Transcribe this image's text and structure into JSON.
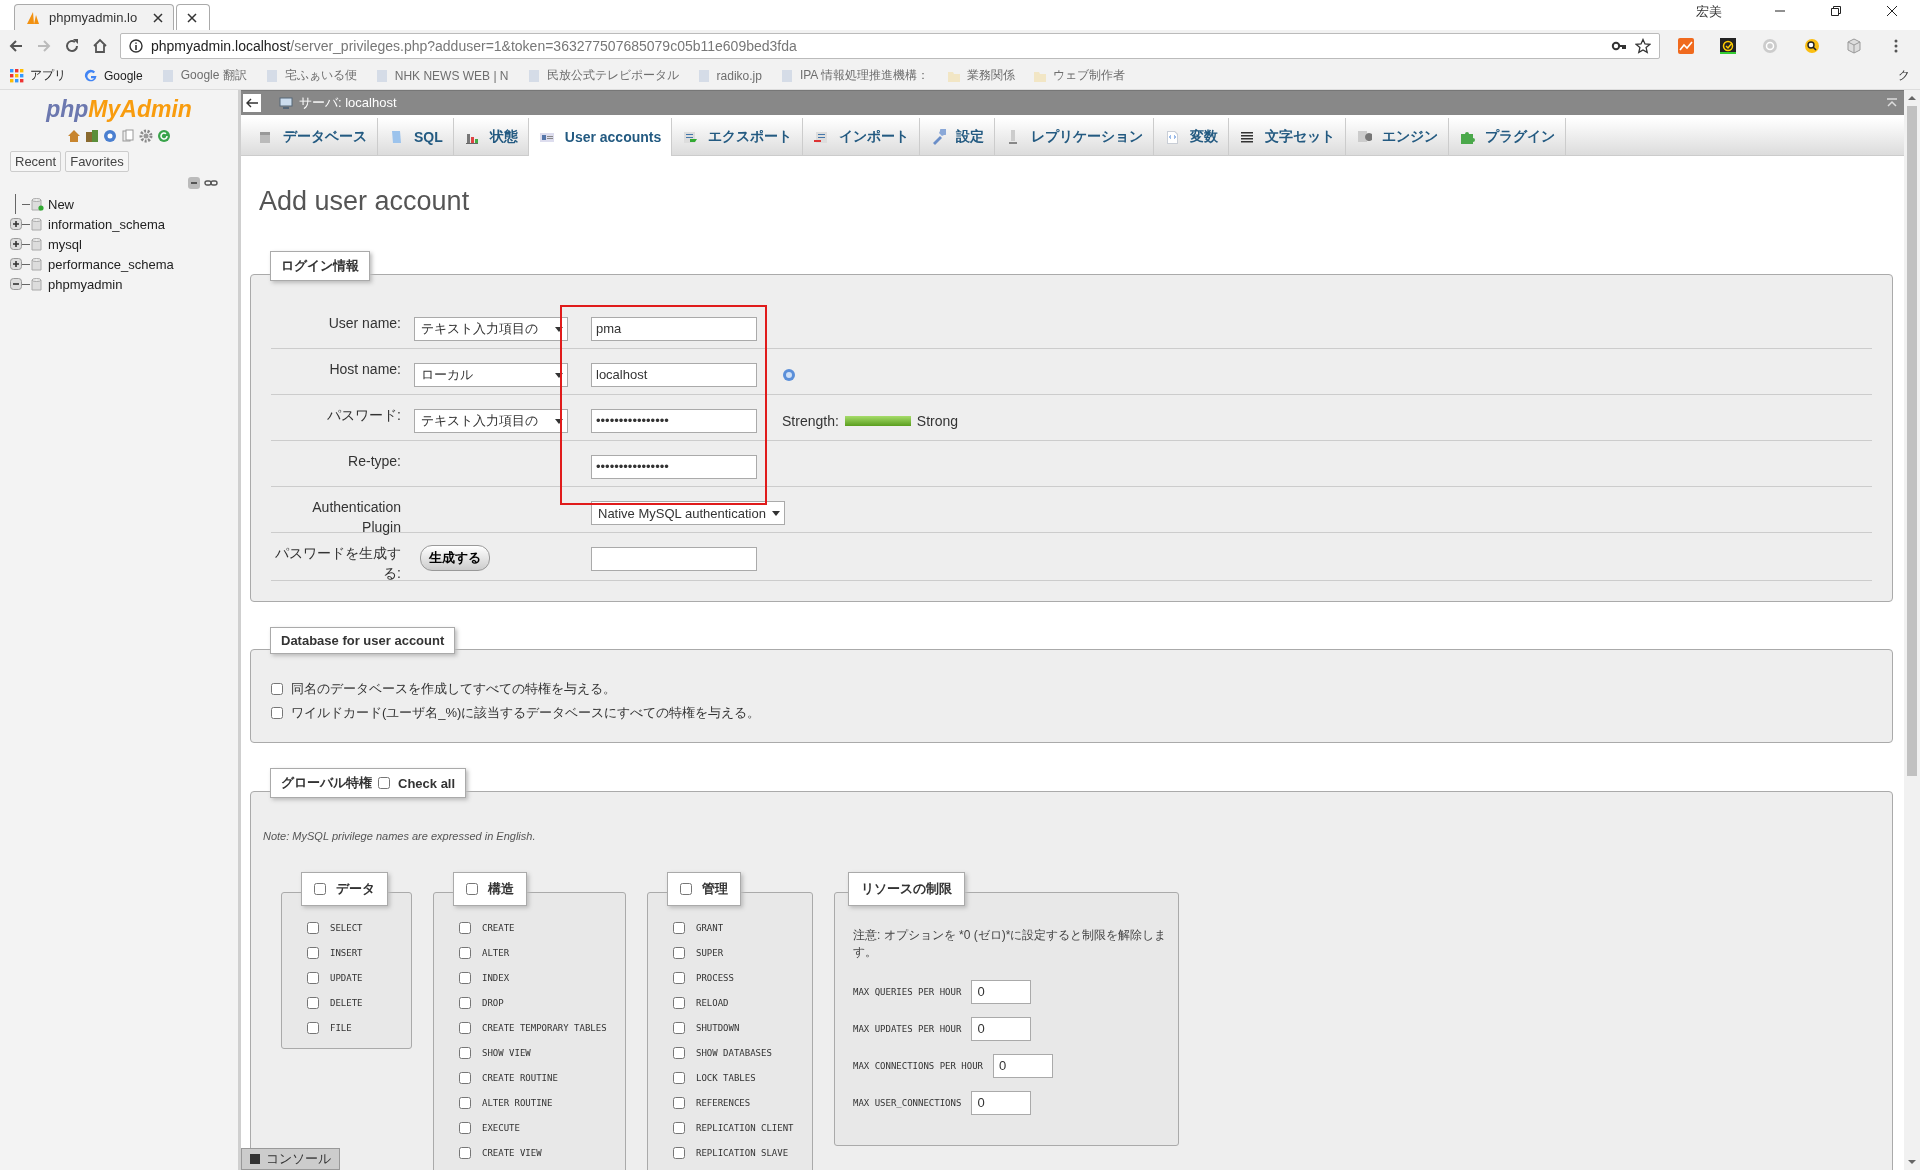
{
  "browser": {
    "tab_title": "phpmyadmin.lo",
    "profile": "宏美",
    "url_host": "phpmyadmin.localhost",
    "url_path": "/server_privileges.php?adduser=1&token=363277507685079c05b11e609bed3fda",
    "bookmarks": [
      {
        "label": "アプリ",
        "kind": "apps",
        "faded": false
      },
      {
        "label": "Google",
        "kind": "google",
        "faded": false
      },
      {
        "label": "Google 翻訳",
        "kind": "page",
        "faded": true
      },
      {
        "label": "宅ふぁいる便",
        "kind": "page",
        "faded": true
      },
      {
        "label": "NHK NEWS WEB | N",
        "kind": "page",
        "faded": true
      },
      {
        "label": "民放公式テレビポータル",
        "kind": "page",
        "faded": true
      },
      {
        "label": "radiko.jp",
        "kind": "page",
        "faded": true
      },
      {
        "label": "IPA 情報処理推進機構：",
        "kind": "page",
        "faded": true
      },
      {
        "label": "業務関係",
        "kind": "folder",
        "faded": true
      },
      {
        "label": "ウェブ制作者",
        "kind": "folder",
        "faded": true
      }
    ],
    "overflow": "ク"
  },
  "sidebar": {
    "logo_prefix": "php",
    "logo_name": "MyAdmin",
    "buttons": [
      "Recent",
      "Favorites"
    ],
    "tree": [
      {
        "label": "New",
        "kind": "new"
      },
      {
        "label": "information_schema",
        "kind": "database",
        "expanded": false
      },
      {
        "label": "mysql",
        "kind": "database",
        "expanded": false
      },
      {
        "label": "performance_schema",
        "kind": "database",
        "expanded": false
      },
      {
        "label": "phpmyadmin",
        "kind": "database",
        "expanded": true
      }
    ]
  },
  "server_bar": "サーバ: localhost",
  "nav_tabs": [
    {
      "label": "データベース",
      "selected": false
    },
    {
      "label": "SQL",
      "selected": false
    },
    {
      "label": "状態",
      "selected": false
    },
    {
      "label": "User accounts",
      "selected": true
    },
    {
      "label": "エクスポート",
      "selected": false
    },
    {
      "label": "インポート",
      "selected": false
    },
    {
      "label": "設定",
      "selected": false
    },
    {
      "label": "レプリケーション",
      "selected": false
    },
    {
      "label": "変数",
      "selected": false
    },
    {
      "label": "文字セット",
      "selected": false
    },
    {
      "label": "エンジン",
      "selected": false
    },
    {
      "label": "プラグイン",
      "selected": false
    }
  ],
  "heading": "Add user account",
  "login": {
    "legend": "ログイン情報",
    "rows": [
      {
        "kind": "select-input",
        "label": "User name:",
        "select": "テキスト入力項目の",
        "value": "pma",
        "help": false
      },
      {
        "kind": "select-input",
        "label": "Host name:",
        "select": "ローカル",
        "value": "localhost",
        "help": true
      },
      {
        "kind": "select-input",
        "label": "パスワード:",
        "select": "テキスト入力項目の",
        "value": "••••••••••••••••",
        "help": false,
        "strength": {
          "label": "Strength:",
          "level": 1,
          "text": "Strong"
        }
      },
      {
        "kind": "input",
        "label": "Re-type:",
        "value": "••••••••••••••••"
      },
      {
        "kind": "plugin",
        "label": "Authentication Plugin",
        "select": "Native MySQL authentication"
      },
      {
        "kind": "generate",
        "label": "パスワードを生成する:",
        "button": "生成する"
      }
    ]
  },
  "database": {
    "legend": "Database for user account",
    "options": [
      {
        "label": "同名のデータベースを作成してすべての特権を与える。",
        "checked": false
      },
      {
        "label": "ワイルドカード(ユーザ名_%)に該当するデータベースにすべての特権を与える。",
        "checked": false
      }
    ]
  },
  "privileges": {
    "legend": "グローバル特権",
    "check_all": {
      "label": "Check all",
      "checked": false
    },
    "note": "Note: MySQL privilege names are expressed in English.",
    "groups": [
      {
        "title": "データ",
        "checked": false,
        "items": [
          {
            "label": "SELECT",
            "checked": false
          },
          {
            "label": "INSERT",
            "checked": false
          },
          {
            "label": "UPDATE",
            "checked": false
          },
          {
            "label": "DELETE",
            "checked": false
          },
          {
            "label": "FILE",
            "checked": false
          }
        ]
      },
      {
        "title": "構造",
        "checked": false,
        "items": [
          {
            "label": "CREATE",
            "checked": false
          },
          {
            "label": "ALTER",
            "checked": false
          },
          {
            "label": "INDEX",
            "checked": false
          },
          {
            "label": "DROP",
            "checked": false
          },
          {
            "label": "CREATE TEMPORARY TABLES",
            "checked": false
          },
          {
            "label": "SHOW VIEW",
            "checked": false
          },
          {
            "label": "CREATE ROUTINE",
            "checked": false
          },
          {
            "label": "ALTER ROUTINE",
            "checked": false
          },
          {
            "label": "EXECUTE",
            "checked": false
          },
          {
            "label": "CREATE VIEW",
            "checked": false
          }
        ]
      },
      {
        "title": "管理",
        "checked": false,
        "items": [
          {
            "label": "GRANT",
            "checked": false
          },
          {
            "label": "SUPER",
            "checked": false
          },
          {
            "label": "PROCESS",
            "checked": false
          },
          {
            "label": "RELOAD",
            "checked": false
          },
          {
            "label": "SHUTDOWN",
            "checked": false
          },
          {
            "label": "SHOW DATABASES",
            "checked": false
          },
          {
            "label": "LOCK TABLES",
            "checked": false
          },
          {
            "label": "REFERENCES",
            "checked": false
          },
          {
            "label": "REPLICATION CLIENT",
            "checked": false
          },
          {
            "label": "REPLICATION SLAVE",
            "checked": false
          }
        ]
      }
    ],
    "limits": {
      "legend": "リソースの制限",
      "note": "注意: オプションを *0 (ゼロ)*に設定すると制限を解除します。",
      "fields": [
        {
          "label": "MAX QUERIES PER HOUR",
          "value": "0"
        },
        {
          "label": "MAX UPDATES PER HOUR",
          "value": "0"
        },
        {
          "label": "MAX CONNECTIONS PER HOUR",
          "value": "0"
        },
        {
          "label": "MAX USER_CONNECTIONS",
          "value": "0"
        }
      ]
    }
  },
  "console": "コンソール"
}
